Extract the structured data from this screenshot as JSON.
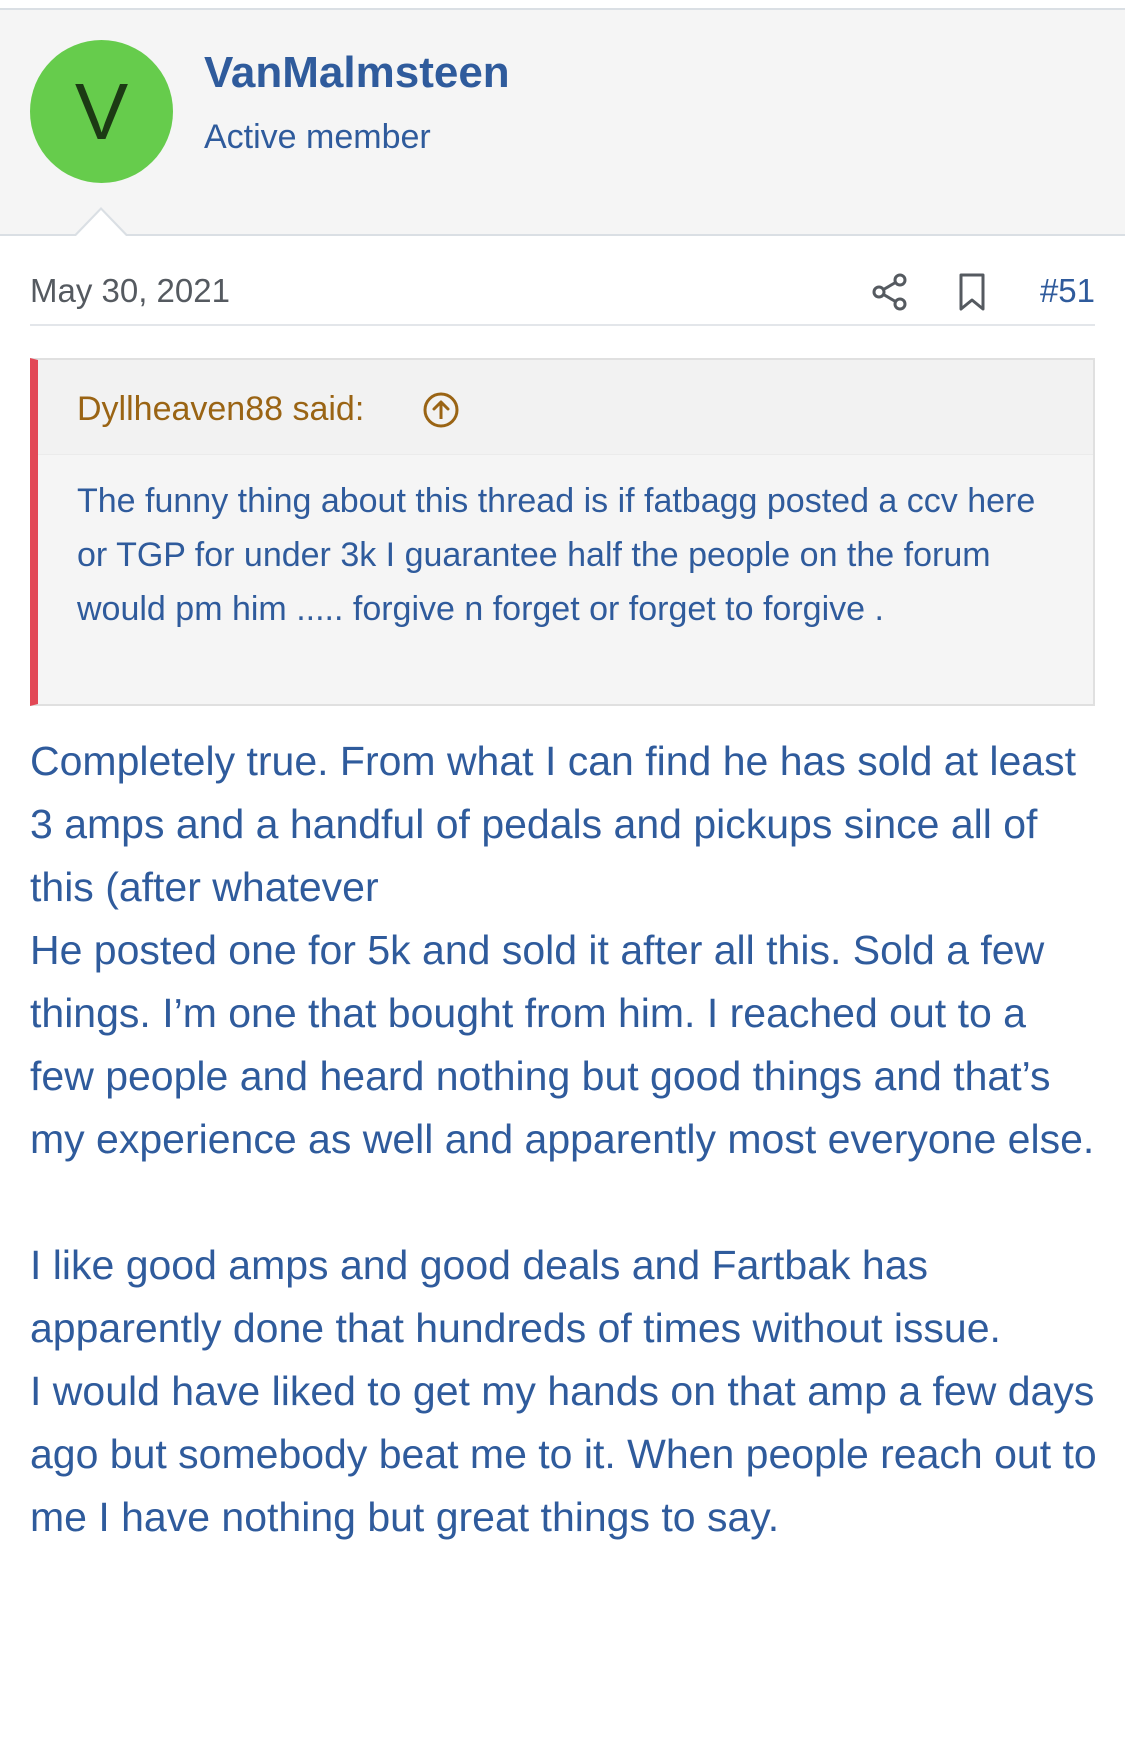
{
  "author": {
    "avatar_letter": "V",
    "avatar_color": "#66cc4c",
    "username": "VanMalmsteen",
    "title": "Active member"
  },
  "post": {
    "date": "May 30, 2021",
    "number": "#51",
    "actions": [
      {
        "icon": "share-icon"
      },
      {
        "icon": "bookmark-icon"
      }
    ]
  },
  "quote": {
    "author_label": "Dyllheaven88 said:",
    "jump_icon": "arrow-up-circle-icon",
    "text": "The funny thing about this thread is if fatbagg posted a ccv here or TGP for under 3k I guarantee half the people on the forum would pm him ..... forgive n forget or forget to forgive ."
  },
  "body": {
    "paragraphs": [
      "Completely true. From what I can find he has sold at least 3 amps and a handful of pedals and pickups since all of this (after whatever",
      "He posted one for 5k and sold it after all this. Sold a few things. I’m one that bought from him. I reached out to a few people and heard nothing but good things and that’s my experience as well and apparently most everyone else.",
      "I like good amps and good deals and Fartbak has apparently done that hundreds of times without issue.",
      "I would have liked to get my hands on that amp a few days ago but somebody beat me to it. When people reach out to me I have nothing but great things to say."
    ]
  },
  "colors": {
    "link_blue": "#2f5b9c",
    "quote_author": "#9a6414",
    "quote_accent": "#e24856",
    "header_bg": "#f5f5f5"
  }
}
